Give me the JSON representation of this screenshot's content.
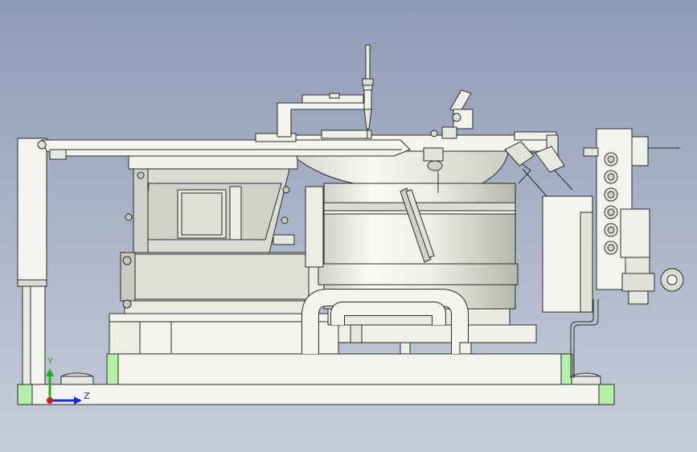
{
  "viewport": {
    "background_top": "#8e9bb5",
    "background_bottom": "#c7ceda"
  },
  "model": {
    "edge_color": "#2a2a2a",
    "part_fill": "#f4f4ef",
    "shade_fill": "#d9dcd2",
    "dark_fill": "#b9bdb2",
    "highlight_green": "#b6f0a8"
  },
  "triad": {
    "y_label": "Y",
    "z_label": "Z",
    "y_color": "#1fae1f",
    "z_color": "#1a2bd8",
    "origin_color": "#d01818"
  }
}
